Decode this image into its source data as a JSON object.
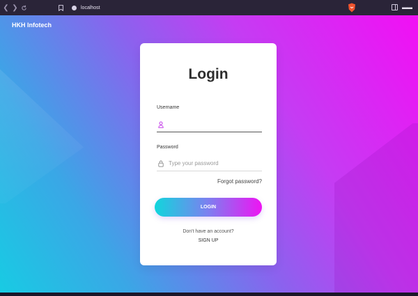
{
  "browser": {
    "url": "localhost",
    "icons": [
      "chevron-left-icon",
      "chevron-right-icon",
      "reload-icon",
      "bookmark-icon",
      "site-info-icon",
      "brave-shield-icon",
      "sidebar-toggle-icon",
      "wallet-icon"
    ]
  },
  "page": {
    "brand": "HKH Infotech",
    "colors": {
      "gradient_start": "#18cbe3",
      "gradient_end": "#f20ff4",
      "button_start": "#11d6dc",
      "button_end": "#ee14f2"
    }
  },
  "login": {
    "title": "Login",
    "username_label": "Username",
    "username_value": "",
    "username_placeholder": "",
    "password_label": "Password",
    "password_value": "",
    "password_placeholder": "Type your password",
    "forgot_label": "Forgot password?",
    "login_button": "LOGIN",
    "signup_prompt": "Don't have an account?",
    "signup_label": "SIGN UP"
  }
}
